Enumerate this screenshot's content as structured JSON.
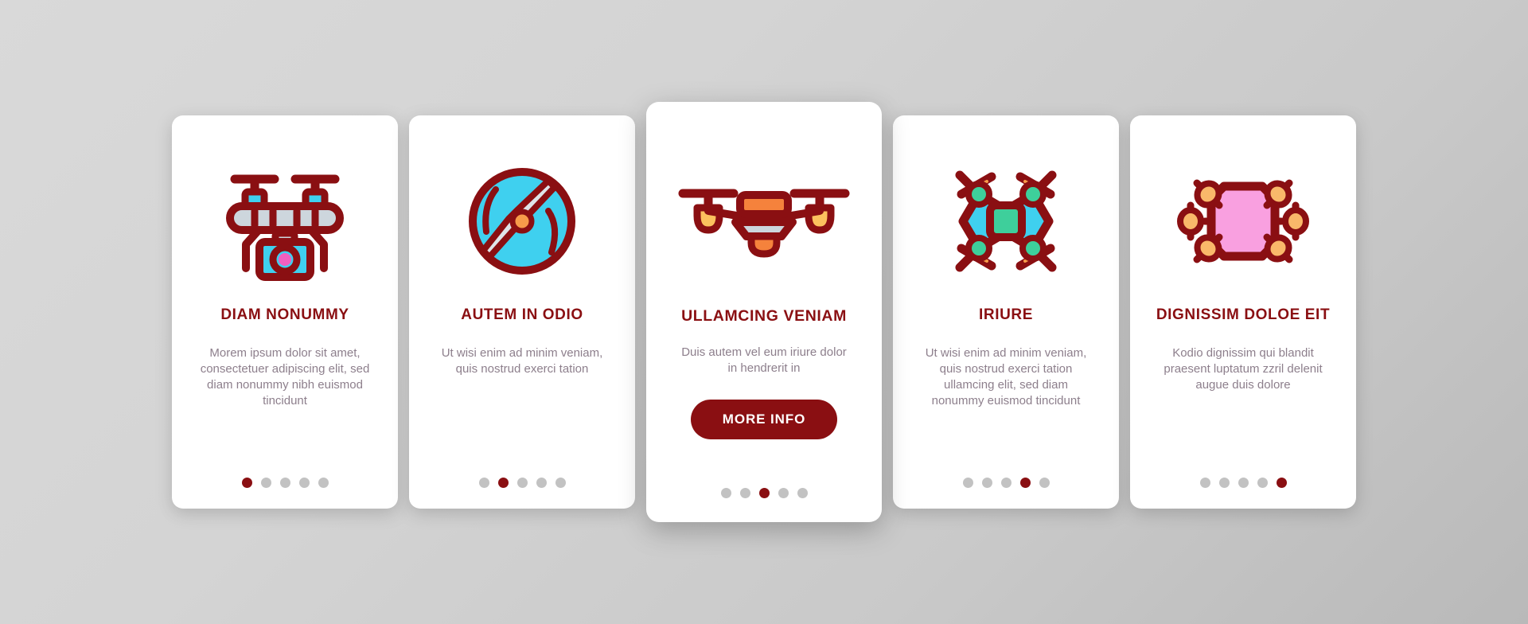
{
  "theme": {
    "background": "#d4d4d4",
    "card_background": "#ffffff",
    "accent_dark_red": "#8a0f12",
    "body_text": "#8d7f8c",
    "dot_inactive": "#c2c2c2",
    "icon_cyan": "#3fd0ef",
    "icon_pink": "#f25fc0",
    "icon_orange": "#f79b4a",
    "icon_green": "#3ecf9b",
    "icon_light_gray": "#cdd6dd",
    "icon_body_pink": "#f9a0e0"
  },
  "cards": [
    {
      "icon": "drone-with-camera-icon",
      "title": "DIAM NONUMMY",
      "body": "Morem ipsum dolor sit amet, consectetuer adipiscing elit, sed diam nonummy nibh euismod tincidunt",
      "dots": {
        "count": 5,
        "active_index": 0
      },
      "featured": false,
      "button": null
    },
    {
      "icon": "propeller-circle-icon",
      "title": "AUTEM IN ODIO",
      "body": "Ut wisi enim ad minim veniam, quis nostrud exerci tation",
      "dots": {
        "count": 5,
        "active_index": 1
      },
      "featured": false,
      "button": null
    },
    {
      "icon": "drone-front-view-icon",
      "title": "ULLAMCING VENIAM",
      "body": "Duis autem vel eum iriure dolor in hendrerit in",
      "dots": {
        "count": 5,
        "active_index": 2
      },
      "featured": true,
      "button": "MORE INFO"
    },
    {
      "icon": "quadcopter-top-view-icon",
      "title": "IRIURE",
      "body": "Ut wisi enim ad minim veniam, quis nostrud exerci tation ullamcing elit, sed diam nonummy euismod tincidunt",
      "dots": {
        "count": 5,
        "active_index": 3
      },
      "featured": false,
      "button": null
    },
    {
      "icon": "hexacopter-icon",
      "title": "DIGNISSIM DOLOE EIT",
      "body": "Kodio dignissim qui blandit praesent luptatum zzril delenit augue duis dolore",
      "dots": {
        "count": 5,
        "active_index": 4
      },
      "featured": false,
      "button": null
    }
  ]
}
